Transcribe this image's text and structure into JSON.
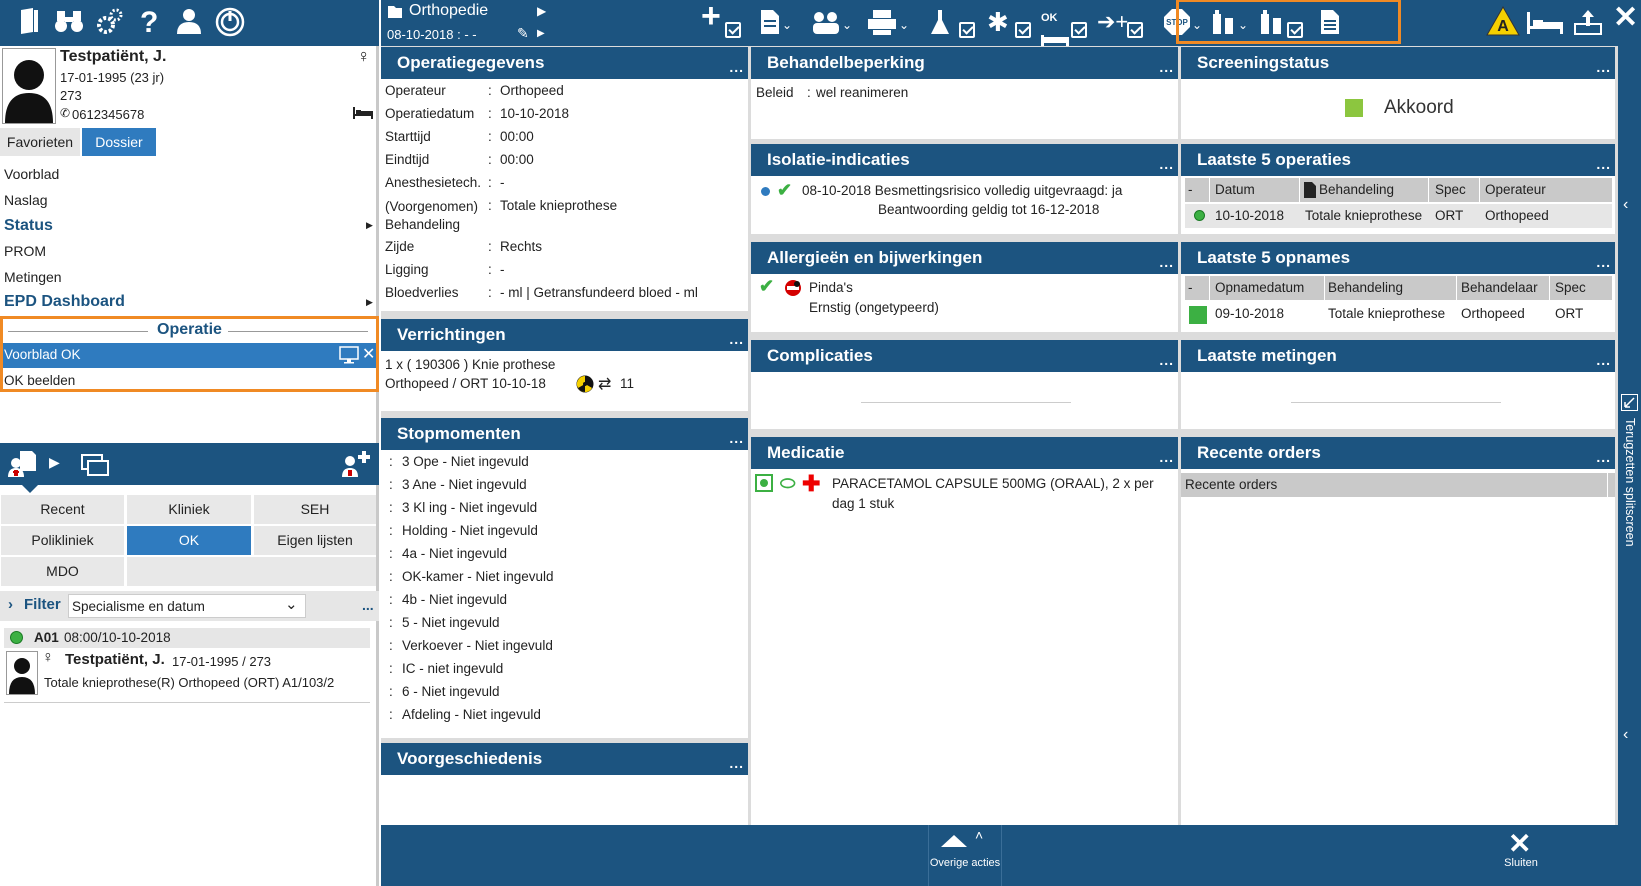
{
  "patient": {
    "name": "Testpatiënt, J.",
    "dob": "17-01-1995 (23 jr)",
    "number": "273",
    "phone": "0612345678"
  },
  "left_tabs": {
    "favorites": "Favorieten",
    "dossier": "Dossier"
  },
  "nav": {
    "voorblad": "Voorblad",
    "naslag": "Naslag",
    "status": "Status",
    "prom": "PROM",
    "metingen": "Metingen",
    "epd": "EPD Dashboard",
    "operatie_header": "Operatie",
    "voorblad_ok": "Voorblad OK",
    "ok_beelden": "OK beelden"
  },
  "worklist": {
    "buttons": [
      "Recent",
      "Kliniek",
      "SEH",
      "Polikliniek",
      "OK",
      "Eigen lijsten",
      "MDO"
    ],
    "filter_label": "Filter",
    "filter_value": "Specialisme en datum",
    "entry_code": "A01",
    "entry_time": "08:00/10-10-2018",
    "entry_name": "Testpatiënt, J.",
    "entry_dob": "17-01-1995 / 273",
    "entry_desc": "Totale knieprothese(R) Orthopeed (ORT) A1/103/2"
  },
  "context": {
    "title": "Orthopedie",
    "date": "08-10-2018 :  -  -"
  },
  "operatiegegevens": {
    "title": "Operatiegegevens",
    "rows": [
      {
        "label": "Operateur",
        "value": "Orthopeed"
      },
      {
        "label": "Operatiedatum",
        "value": "10-10-2018"
      },
      {
        "label": "Starttijd",
        "value": "00:00"
      },
      {
        "label": "Eindtijd",
        "value": "00:00"
      },
      {
        "label": "Anesthesietech.",
        "value": "-"
      },
      {
        "label": "(Voorgenomen) Behandeling",
        "value": "Totale knieprothese"
      },
      {
        "label": "Zijde",
        "value": "Rechts"
      },
      {
        "label": "Ligging",
        "value": "-"
      },
      {
        "label": "Bloedverlies",
        "value": "- ml | Getransfundeerd bloed  - ml"
      }
    ]
  },
  "verrichtingen": {
    "title": "Verrichtingen",
    "line1": "1 x ( 190306 ) Knie prothese",
    "line2": "Orthopeed  /  ORT 10-10-18",
    "count": "11"
  },
  "stopmomenten": {
    "title": "Stopmomenten",
    "items": [
      "3 Ope - Niet ingevuld",
      "3 Ane - Niet ingevuld",
      "3 Kl ing - Niet ingevuld",
      "Holding - Niet ingevuld",
      "4a - Niet ingevuld",
      "OK-kamer - Niet ingevuld",
      "4b - Niet ingevuld",
      "5 - Niet ingevuld",
      "Verkoever - Niet ingevuld",
      "IC - niet ingevuld",
      "6 - Niet ingevuld",
      "Afdeling - Niet ingevuld"
    ]
  },
  "voorgeschiedenis": {
    "title": "Voorgeschiedenis"
  },
  "behandelbeperking": {
    "title": "Behandelbeperking",
    "label": "Beleid",
    "value": "wel reanimeren"
  },
  "isolatie": {
    "title": "Isolatie-indicaties",
    "line1": "08-10-2018 Besmettingsrisico volledig uitgevraagd: ja",
    "line2": "Beantwoording geldig tot 16-12-2018"
  },
  "allergie": {
    "title": "Allergieën en bijwerkingen",
    "name": "Pinda's",
    "severity": "Ernstig (ongetypeerd)"
  },
  "complicaties": {
    "title": "Complicaties"
  },
  "medicatie": {
    "title": "Medicatie",
    "line1": "PARACETAMOL CAPSULE 500MG (ORAAL), 2 x per",
    "line2": "dag 1 stuk"
  },
  "screening": {
    "title": "Screeningstatus",
    "status": "Akkoord",
    "status_color": "#8cc63f"
  },
  "operaties": {
    "title": "Laatste 5 operaties",
    "headers": [
      "-",
      "Datum",
      "Behandeling",
      "Spec",
      "Operateur"
    ],
    "row": [
      "10-10-2018",
      "Totale knieprothese",
      "ORT",
      "Orthopeed"
    ]
  },
  "opnames": {
    "title": "Laatste 5 opnames",
    "headers": [
      "-",
      "Opnamedatum",
      "Behandeling",
      "Behandelaar",
      "Spec"
    ],
    "row": [
      "09-10-2018",
      "Totale knieprothese",
      "Orthopeed",
      "ORT"
    ]
  },
  "metingen": {
    "title": "Laatste metingen"
  },
  "orders": {
    "title": "Recente orders",
    "subheader": "Recente orders"
  },
  "bottom": {
    "overige": "Overige acties",
    "sluiten": "Sluiten"
  },
  "splitscreen": "Terugzetten splitscreen",
  "accent_color": "#1c5480",
  "highlight_color": "#f08a24"
}
